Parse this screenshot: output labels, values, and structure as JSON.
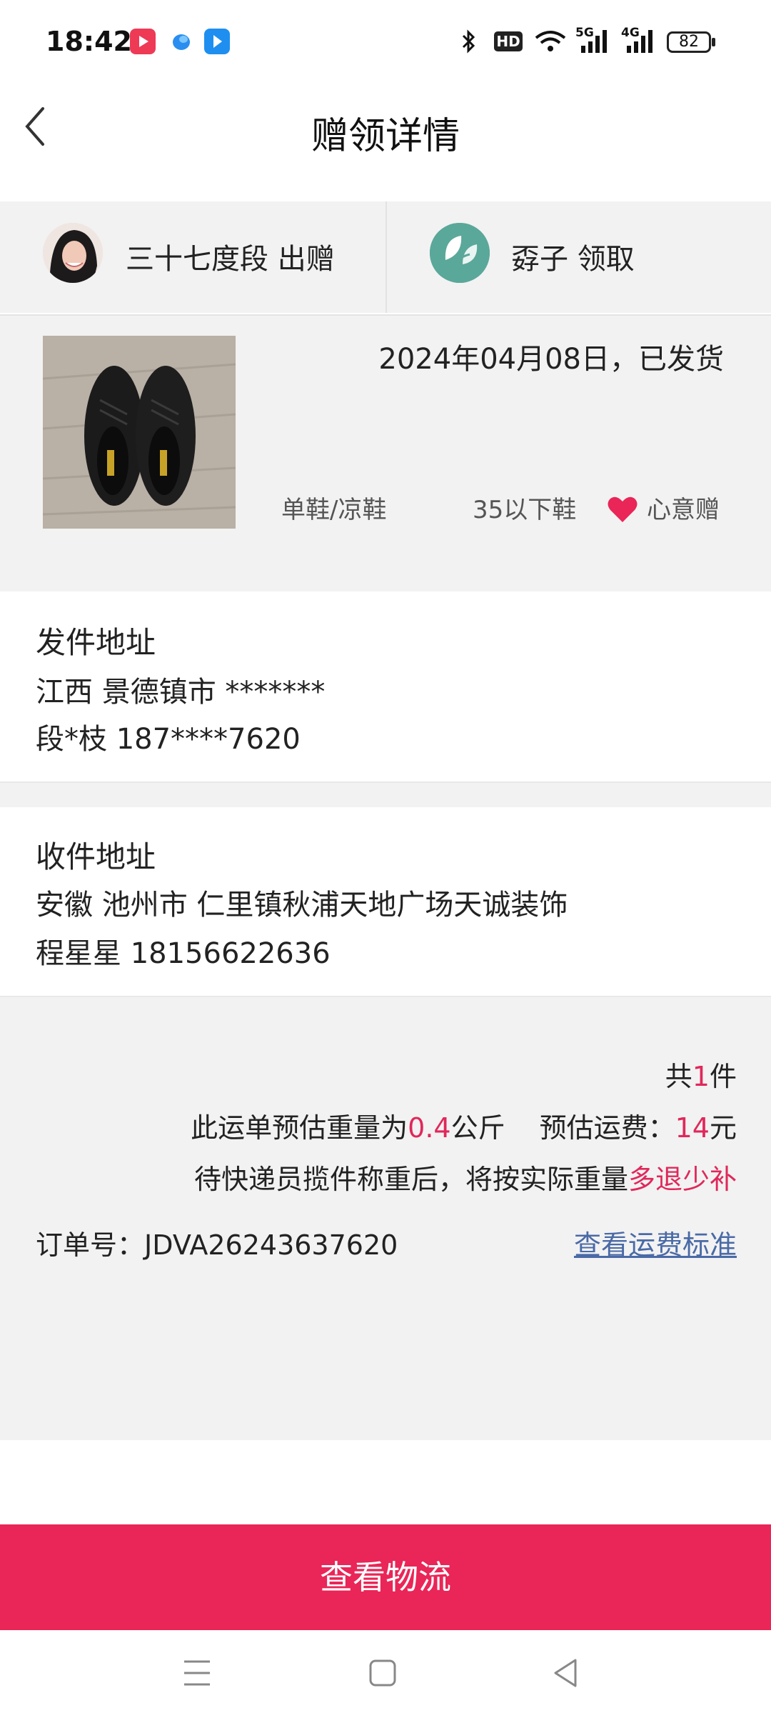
{
  "status_bar": {
    "time": "18:42",
    "battery": "82",
    "network_5g": "5G",
    "network_4g": "4G",
    "hd_badge": "HD",
    "icons": [
      "video-app-icon",
      "browser-app-icon",
      "mail-app-icon",
      "bluetooth-icon",
      "hd-voice-icon",
      "wifi-icon",
      "signal-5g-icon",
      "signal-4g-icon",
      "battery-icon"
    ]
  },
  "header": {
    "title": "赠领详情",
    "back_icon": "chevron-left-icon"
  },
  "parties": {
    "giver_text": "三十七度段 出赠",
    "receiver_text": "孬子 领取"
  },
  "item": {
    "date_status": "2024年04月08日，已发货",
    "category": "单鞋/凉鞋",
    "size": "35以下鞋",
    "gift_type": "心意赠"
  },
  "sender": {
    "heading": "发件地址",
    "region": "江西 景德镇市 *******",
    "contact": "段*枝 187****7620"
  },
  "receiver": {
    "heading": "收件地址",
    "address": "安徽 池州市 仁里镇秋浦天地广场天诚装饰",
    "contact": "程星星 18156622636"
  },
  "shipping": {
    "count_prefix": "共",
    "count": "1",
    "count_suffix": "件",
    "weight_prefix": "此运单预估重量为",
    "weight": "0.4",
    "weight_unit": "公斤",
    "fee_prefix": "预估运费：",
    "fee": "14",
    "fee_unit": "元",
    "note_prefix": "待快递员揽件称重后，将按实际重量",
    "note_highlight": "多退少补",
    "order_label": "订单号：",
    "order_no": "JDVA26243637620",
    "standard_link": "查看运费标准"
  },
  "action": {
    "button": "查看物流"
  },
  "colors": {
    "accent": "#ea2557",
    "highlight_text": "#e0285a",
    "link": "#4a6aa6",
    "panel_bg": "#f2f2f2"
  }
}
